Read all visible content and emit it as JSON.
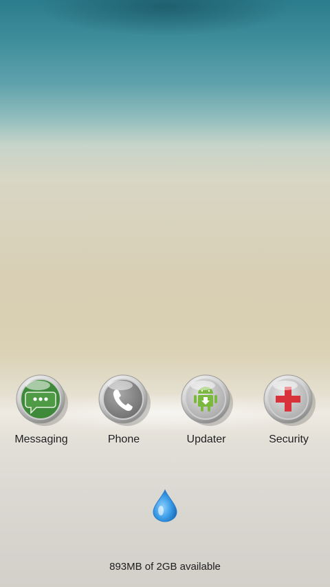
{
  "dock": {
    "apps": [
      {
        "label": "Messaging",
        "icon": "message-bubble-icon",
        "accent": "#3f8a3a"
      },
      {
        "label": "Phone",
        "icon": "phone-handset-icon",
        "accent": "#8a8a8a"
      },
      {
        "label": "Updater",
        "icon": "android-update-icon",
        "accent": "#7ab83e"
      },
      {
        "label": "Security",
        "icon": "red-cross-icon",
        "accent": "#d8333a"
      }
    ]
  },
  "memory": {
    "text": "893MB of 2GB available"
  },
  "cleaner": {
    "icon": "water-drop-icon",
    "color": "#3a9be6"
  }
}
